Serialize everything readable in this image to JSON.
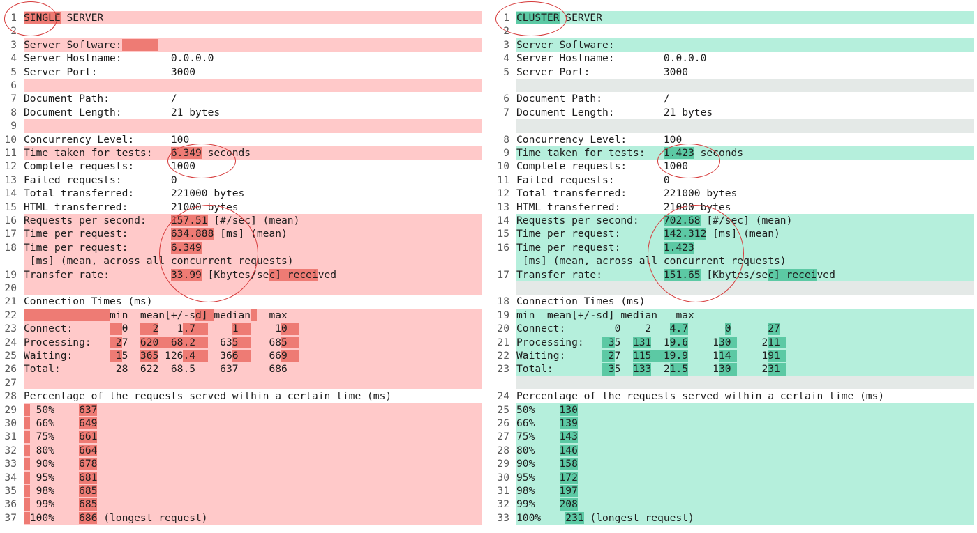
{
  "colors": {
    "left_bg": "#ffc9c9",
    "left_mark": "#ee7b74",
    "right_bg": "#b5efdc",
    "right_mark": "#5cc9a4",
    "blank_gray": "#e4e9e7",
    "circle": "#d63a3a",
    "line_number": "#5a5a5a",
    "text": "#1e1e1e"
  },
  "left": {
    "lines": [
      {
        "num": "1",
        "text": "SINGLE SERVER",
        "bg": "add"
      },
      {
        "num": "2",
        "text": "",
        "bg": "none"
      },
      {
        "num": "3",
        "text": "Server Software:",
        "bg": "add"
      },
      {
        "num": "4",
        "text": "Server Hostname:        0.0.0.0",
        "bg": "none"
      },
      {
        "num": "5",
        "text": "Server Port:            3000",
        "bg": "none"
      },
      {
        "num": "6",
        "text": "",
        "bg": "add"
      },
      {
        "num": "7",
        "text": "Document Path:          /",
        "bg": "none"
      },
      {
        "num": "8",
        "text": "Document Length:        21 bytes",
        "bg": "none"
      },
      {
        "num": "9",
        "text": "",
        "bg": "add"
      },
      {
        "num": "10",
        "text": "Concurrency Level:      100",
        "bg": "none"
      },
      {
        "num": "11",
        "text": "Time taken for tests:   6.349 seconds",
        "bg": "add"
      },
      {
        "num": "12",
        "text": "Complete requests:      1000",
        "bg": "none"
      },
      {
        "num": "13",
        "text": "Failed requests:        0",
        "bg": "none"
      },
      {
        "num": "14",
        "text": "Total transferred:      221000 bytes",
        "bg": "none"
      },
      {
        "num": "15",
        "text": "HTML transferred:       21000 bytes",
        "bg": "none"
      },
      {
        "num": "16",
        "text": "Requests per second:    157.51 [#/sec] (mean)",
        "bg": "add"
      },
      {
        "num": "17",
        "text": "Time per request:       634.888 [ms] (mean)",
        "bg": "add"
      },
      {
        "num": "18",
        "text": "Time per request:       6.349",
        "bg": "add"
      },
      {
        "num": "",
        "text": " [ms] (mean, across all concurrent requests)",
        "bg": "add"
      },
      {
        "num": "19",
        "text": "Transfer rate:          33.99 [Kbytes/sec] received",
        "bg": "add"
      },
      {
        "num": "20",
        "text": "",
        "bg": "add"
      },
      {
        "num": "21",
        "text": "Connection Times (ms)",
        "bg": "none"
      },
      {
        "num": "22",
        "text": "              min  mean[+/-sd] median   max",
        "bg": "add"
      },
      {
        "num": "23",
        "text": "Connect:        0    2   1.7      1      10",
        "bg": "add"
      },
      {
        "num": "24",
        "text": "Processing:    27  620  68.2    635     685",
        "bg": "add"
      },
      {
        "num": "25",
        "text": "Waiting:       15  365 126.4    366     669",
        "bg": "add"
      },
      {
        "num": "26",
        "text": "Total:         28  622  68.5    637     686",
        "bg": "add"
      },
      {
        "num": "27",
        "text": "",
        "bg": "add"
      },
      {
        "num": "28",
        "text": "Percentage of the requests served within a certain time (ms)",
        "bg": "none"
      },
      {
        "num": "29",
        "text": "  50%    637",
        "bg": "add"
      },
      {
        "num": "30",
        "text": "  66%    649",
        "bg": "add"
      },
      {
        "num": "31",
        "text": "  75%    661",
        "bg": "add"
      },
      {
        "num": "32",
        "text": "  80%    664",
        "bg": "add"
      },
      {
        "num": "33",
        "text": "  90%    678",
        "bg": "add"
      },
      {
        "num": "34",
        "text": "  95%    681",
        "bg": "add"
      },
      {
        "num": "35",
        "text": "  98%    685",
        "bg": "add"
      },
      {
        "num": "36",
        "text": "  99%    685",
        "bg": "add"
      },
      {
        "num": "37",
        "text": " 100%    686 (longest request)",
        "bg": "add"
      }
    ]
  },
  "right": {
    "lines": [
      {
        "num": "1",
        "text": "CLUSTER SERVER",
        "bg": "add"
      },
      {
        "num": "2",
        "text": "",
        "bg": "none"
      },
      {
        "num": "3",
        "text": "Server Software:",
        "bg": "add"
      },
      {
        "num": "4",
        "text": "Server Hostname:        0.0.0.0",
        "bg": "none"
      },
      {
        "num": "5",
        "text": "Server Port:            3000",
        "bg": "none"
      },
      {
        "num": "",
        "text": "",
        "bg": "gray"
      },
      {
        "num": "6",
        "text": "Document Path:          /",
        "bg": "none"
      },
      {
        "num": "7",
        "text": "Document Length:        21 bytes",
        "bg": "none"
      },
      {
        "num": "",
        "text": "",
        "bg": "gray"
      },
      {
        "num": "8",
        "text": "Concurrency Level:      100",
        "bg": "none"
      },
      {
        "num": "9",
        "text": "Time taken for tests:   1.423 seconds",
        "bg": "add"
      },
      {
        "num": "10",
        "text": "Complete requests:      1000",
        "bg": "none"
      },
      {
        "num": "11",
        "text": "Failed requests:        0",
        "bg": "none"
      },
      {
        "num": "12",
        "text": "Total transferred:      221000 bytes",
        "bg": "none"
      },
      {
        "num": "13",
        "text": "HTML transferred:       21000 bytes",
        "bg": "none"
      },
      {
        "num": "14",
        "text": "Requests per second:    702.68 [#/sec] (mean)",
        "bg": "add"
      },
      {
        "num": "15",
        "text": "Time per request:       142.312 [ms] (mean)",
        "bg": "add"
      },
      {
        "num": "16",
        "text": "Time per request:       1.423",
        "bg": "add"
      },
      {
        "num": "",
        "text": " [ms] (mean, across all concurrent requests)",
        "bg": "add"
      },
      {
        "num": "17",
        "text": "Transfer rate:          151.65 [Kbytes/sec] received",
        "bg": "add"
      },
      {
        "num": "",
        "text": "",
        "bg": "gray"
      },
      {
        "num": "18",
        "text": "Connection Times (ms)",
        "bg": "none"
      },
      {
        "num": "19",
        "text": "min  mean[+/-sd] median   max",
        "bg": "add"
      },
      {
        "num": "20",
        "text": "Connect:        0    2   4.7      0      27",
        "bg": "add"
      },
      {
        "num": "21",
        "text": "Processing:    35  131  19.6    130     211",
        "bg": "add"
      },
      {
        "num": "22",
        "text": "Waiting:       27  115  19.9    114     191",
        "bg": "add"
      },
      {
        "num": "23",
        "text": "Total:         35  133  21.5    130     231",
        "bg": "add"
      },
      {
        "num": "",
        "text": "",
        "bg": "gray"
      },
      {
        "num": "24",
        "text": "Percentage of the requests served within a certain time (ms)",
        "bg": "none"
      },
      {
        "num": "25",
        "text": "50%    130",
        "bg": "add"
      },
      {
        "num": "26",
        "text": "66%    139",
        "bg": "add"
      },
      {
        "num": "27",
        "text": "75%    143",
        "bg": "add"
      },
      {
        "num": "28",
        "text": "80%    146",
        "bg": "add"
      },
      {
        "num": "29",
        "text": "90%    158",
        "bg": "add"
      },
      {
        "num": "30",
        "text": "95%    172",
        "bg": "add"
      },
      {
        "num": "31",
        "text": "98%    197",
        "bg": "add"
      },
      {
        "num": "32",
        "text": "99%    208",
        "bg": "add"
      },
      {
        "num": "33",
        "text": "100%    231 (longest request)",
        "bg": "add"
      }
    ]
  }
}
